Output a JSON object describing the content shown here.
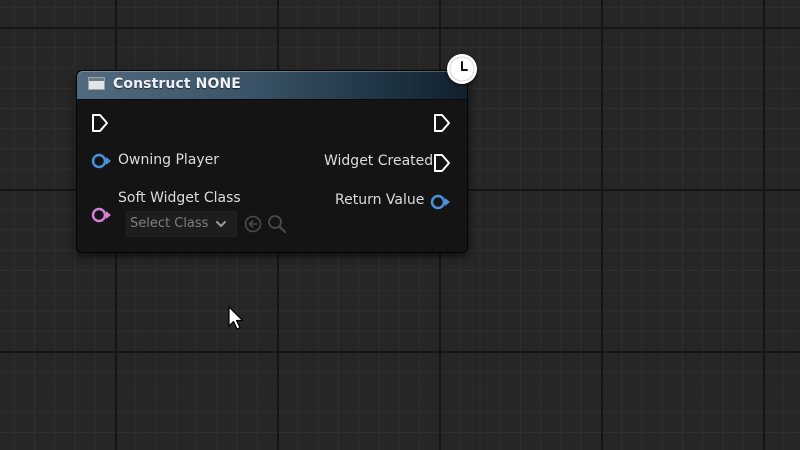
{
  "node": {
    "title": "Construct NONE",
    "header_icon": "widget-window-icon",
    "latent_icon": "clock-icon"
  },
  "pins": {
    "left": [
      {
        "name": "exec-in",
        "type": "exec",
        "label": ""
      },
      {
        "name": "owning-player",
        "type": "object",
        "color": "#4a90d9",
        "label": "Owning Player"
      },
      {
        "name": "soft-widget-class",
        "type": "soft-class",
        "color": "#d67ed6",
        "label": "Soft Widget Class"
      }
    ],
    "right": [
      {
        "name": "exec-out",
        "type": "exec",
        "label": ""
      },
      {
        "name": "widget-created",
        "type": "exec",
        "label": "Widget Created"
      },
      {
        "name": "return-value",
        "type": "object",
        "color": "#4a90d9",
        "label": "Return Value"
      }
    ]
  },
  "class_picker": {
    "placeholder": "Select Class",
    "icons": [
      "chevron-down-icon",
      "use-selected-icon",
      "browse-search-icon"
    ]
  },
  "colors": {
    "object_pin": "#4a90d9",
    "soft_class_pin": "#d67ed6",
    "exec_pin": "#ffffff",
    "header": "#3a5366"
  }
}
